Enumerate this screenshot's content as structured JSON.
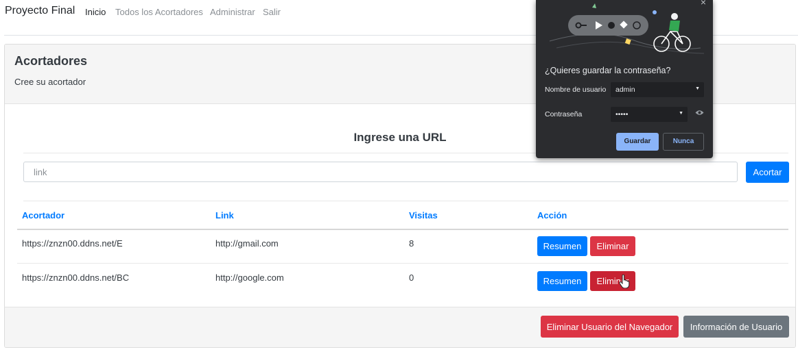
{
  "navbar": {
    "brand": "Proyecto Final",
    "links": [
      "Inicio",
      "Todos los Acortadores",
      "Administrar",
      "Salir"
    ]
  },
  "card": {
    "title": "Acortadores",
    "subtitle": "Cree su acortador",
    "url_heading": "Ingrese una URL",
    "input_placeholder": "link",
    "input_value": "",
    "submit_label": "Acortar"
  },
  "table": {
    "headers": [
      "Acortador",
      "Link",
      "Visitas",
      "Acción"
    ],
    "rows": [
      {
        "short": "https://znzn00.ddns.net/E",
        "link": "http://gmail.com",
        "visits": "8",
        "summary_label": "Resumen",
        "delete_label": "Eliminar"
      },
      {
        "short": "https://znzn00.ddns.net/BC",
        "link": "http://google.com",
        "visits": "0",
        "summary_label": "Resumen",
        "delete_label": "Eliminar"
      }
    ]
  },
  "footer": {
    "delete_user_label": "Eliminar Usuario del Navegador",
    "user_info_label": "Información de Usuario"
  },
  "password_popup": {
    "close": "×",
    "question": "¿Quieres guardar la contraseña?",
    "username_label": "Nombre de usuario",
    "username_value": "admin",
    "password_label": "Contraseña",
    "password_value": "•••••",
    "save_label": "Guardar",
    "never_label": "Nunca"
  },
  "colors": {
    "primary": "#007bff",
    "danger": "#dc3545",
    "secondary": "#6c757d",
    "popup_bg": "#2b2c2f",
    "popup_accent": "#8ab4f8"
  },
  "icons": [
    "pointer-hand-icon",
    "eye-icon",
    "close-icon",
    "chevron-down-icon",
    "key-icon"
  ]
}
